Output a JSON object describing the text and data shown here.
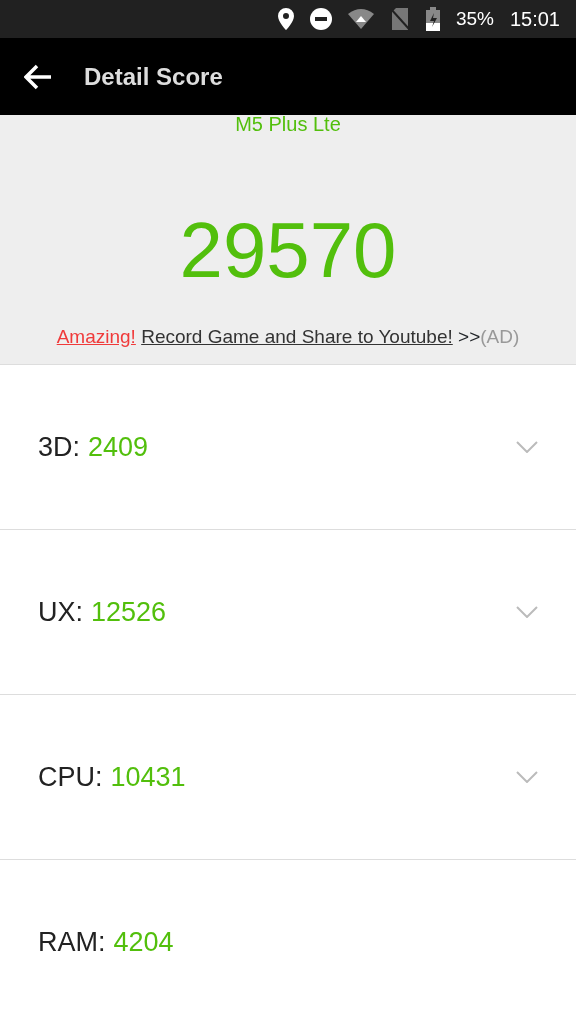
{
  "status_bar": {
    "battery": "35%",
    "time": "15:01"
  },
  "app_bar": {
    "title": "Detail Score"
  },
  "summary": {
    "device": "M5 Plus Lte",
    "total": "29570",
    "ad": {
      "highlight": "Amazing! ",
      "link": "Record Game and Share to Youtube!",
      "arrow": ">>",
      "label": "(AD)"
    }
  },
  "scores": [
    {
      "label": "3D:",
      "value": "2409",
      "expandable": true
    },
    {
      "label": "UX:",
      "value": "12526",
      "expandable": true
    },
    {
      "label": "CPU:",
      "value": "10431",
      "expandable": true
    },
    {
      "label": "RAM:",
      "value": "4204",
      "expandable": false
    }
  ]
}
